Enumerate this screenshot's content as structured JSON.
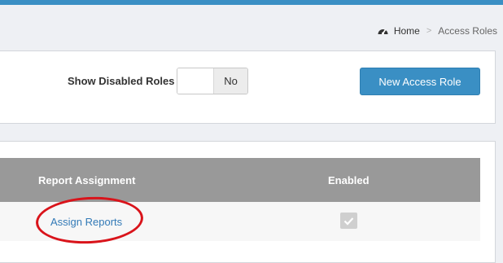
{
  "breadcrumb": {
    "home_icon": "dashboard-gauge-icon",
    "home": "Home",
    "separator": ">",
    "current": "Access Roles"
  },
  "filters": {
    "show_disabled_label": "Show Disabled Roles",
    "toggle_state": "No"
  },
  "actions": {
    "new_role_label": "New Access Role"
  },
  "table": {
    "columns": [
      "Report Assignment",
      "Enabled"
    ],
    "rows": [
      {
        "report_assignment": "Assign Reports",
        "enabled": true
      }
    ]
  },
  "colors": {
    "accent": "#3a8fc4",
    "header_bg": "#999999",
    "link": "#337ab7",
    "highlight": "#d9141b"
  }
}
